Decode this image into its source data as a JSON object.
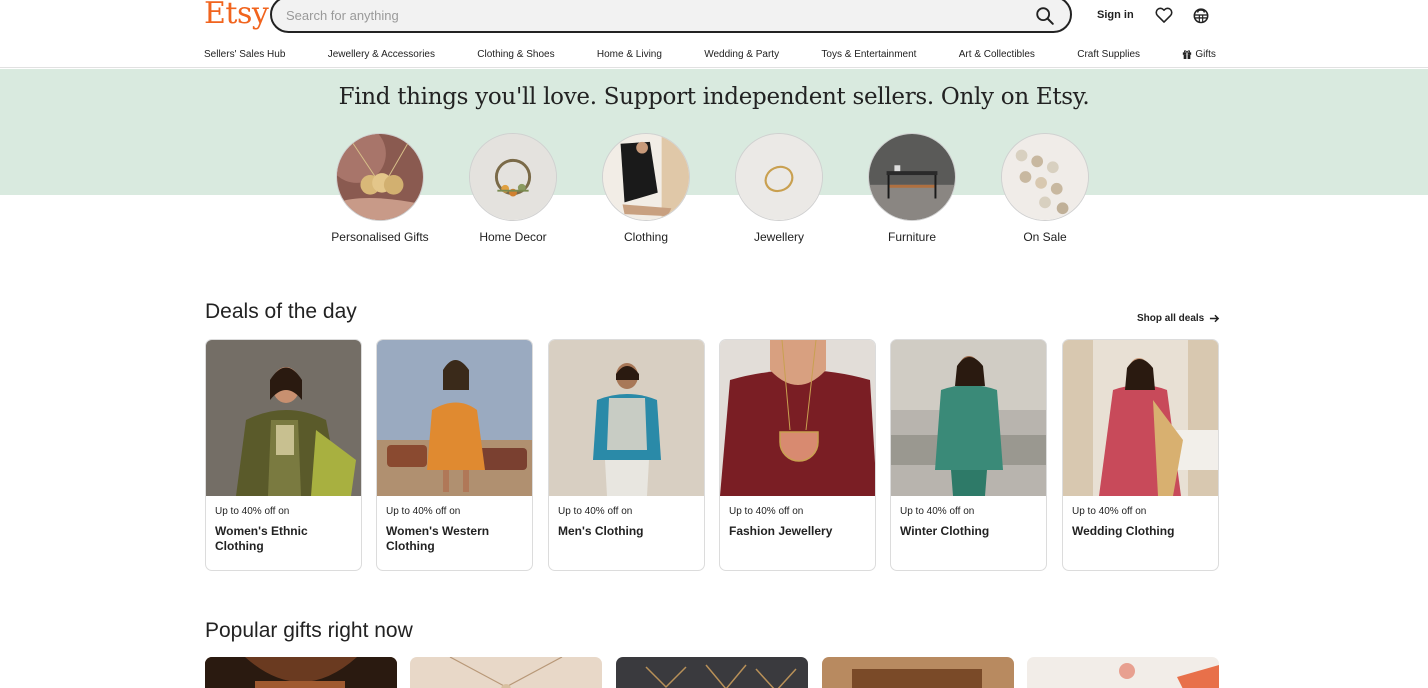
{
  "header": {
    "logo": "Etsy",
    "search": {
      "placeholder": "Search for anything",
      "value": ""
    },
    "sign_in": "Sign in",
    "icons": {
      "search": "search-icon",
      "favorites": "heart-icon",
      "cart": "basket-icon"
    }
  },
  "nav": {
    "items": [
      "Sellers' Sales Hub",
      "Jewellery & Accessories",
      "Clothing & Shoes",
      "Home & Living",
      "Wedding & Party",
      "Toys & Entertainment",
      "Art & Collectibles",
      "Craft Supplies",
      "Gifts"
    ]
  },
  "hero": {
    "title": "Find things you'll love. Support independent sellers. Only on Etsy.",
    "categories": [
      {
        "label": "Personalised Gifts"
      },
      {
        "label": "Home Decor"
      },
      {
        "label": "Clothing"
      },
      {
        "label": "Jewellery"
      },
      {
        "label": "Furniture"
      },
      {
        "label": "On Sale"
      }
    ]
  },
  "deals": {
    "title": "Deals of the day",
    "shop_all": "Shop all deals",
    "items": [
      {
        "offer": "Up to 40% off on",
        "name": "Women's Ethnic Clothing"
      },
      {
        "offer": "Up to 40% off on",
        "name": "Women's Western Clothing"
      },
      {
        "offer": "Up to 40% off on",
        "name": "Men's Clothing"
      },
      {
        "offer": "Up to 40% off on",
        "name": "Fashion Jewellery"
      },
      {
        "offer": "Up to 40% off on",
        "name": "Winter Clothing"
      },
      {
        "offer": "Up to 40% off on",
        "name": "Wedding Clothing"
      }
    ]
  },
  "popular": {
    "title": "Popular gifts right now"
  },
  "colors": {
    "brand": "#f1641e",
    "hero_band": "#d9eadf",
    "text": "#222222"
  }
}
